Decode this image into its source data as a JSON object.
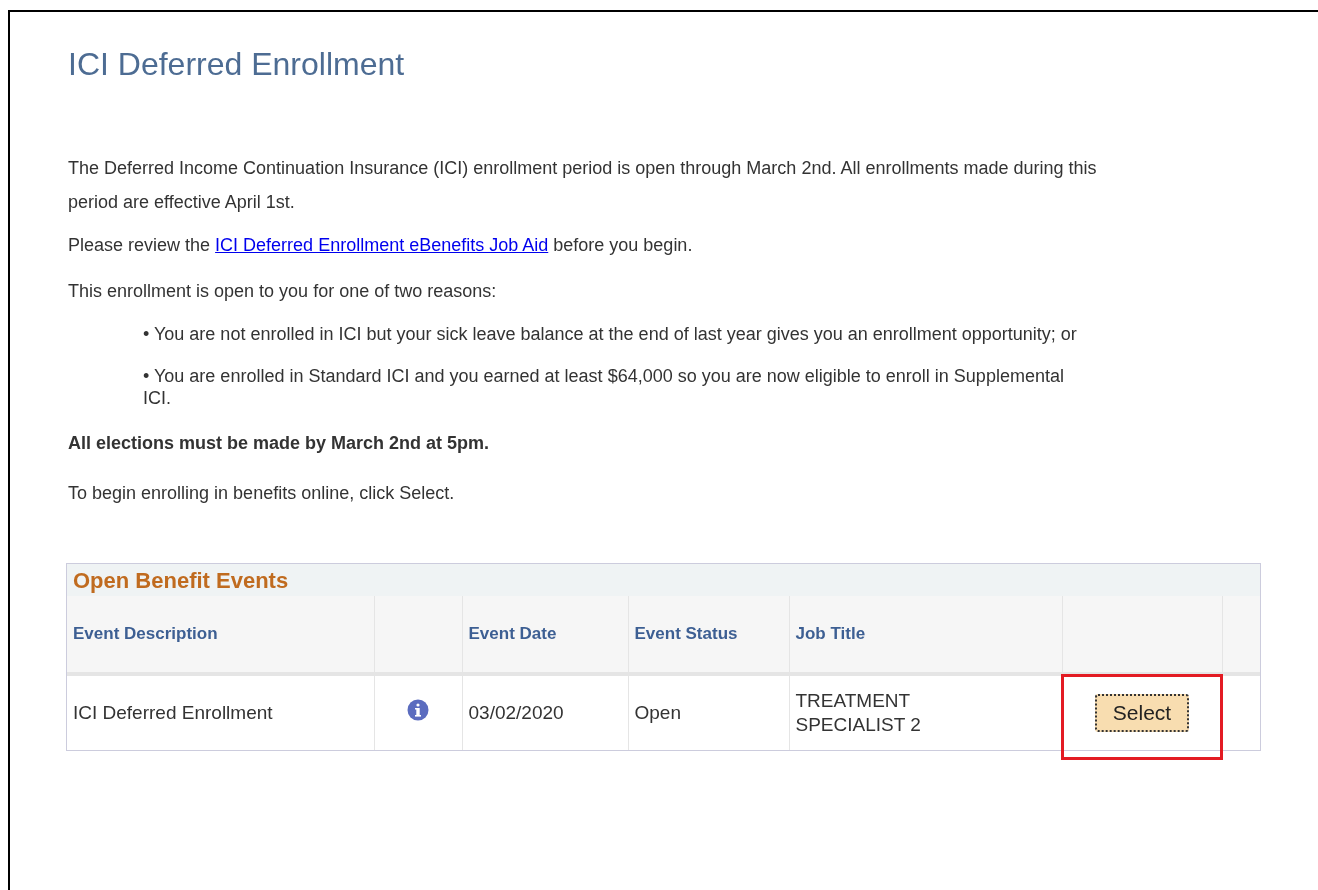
{
  "title": "ICI Deferred Enrollment",
  "intro": "The Deferred Income Continuation Insurance (ICI) enrollment period is open through March 2nd. All enrollments made during this period are effective April 1st.",
  "review": {
    "before": "Please review the",
    "link": "ICI Deferred Enrollment eBenefits Job Aid",
    "after": "before you begin."
  },
  "reasons_intro": "This enrollment is open to you for one of two reasons:",
  "reasons": [
    "• You are not enrolled in ICI but your sick leave balance at the end of last year gives you an enrollment opportunity; or",
    "• You are enrolled in Standard ICI and you earned at least $64,000 so you are now eligible to enroll in Supplemental ICI."
  ],
  "deadline": "All elections must be made by March 2nd at 5pm.",
  "instruction": "To begin enrolling in benefits online, click Select.",
  "table": {
    "title": "Open Benefit Events",
    "columns": [
      "Event Description",
      "Event Date",
      "Event Status",
      "Job Title"
    ],
    "rows": [
      {
        "description": "ICI Deferred Enrollment",
        "date": "03/02/2020",
        "status": "Open",
        "job_title": [
          "TREATMENT",
          "SPECIALIST 2"
        ],
        "button": "Select",
        "highlighted": true
      }
    ]
  }
}
